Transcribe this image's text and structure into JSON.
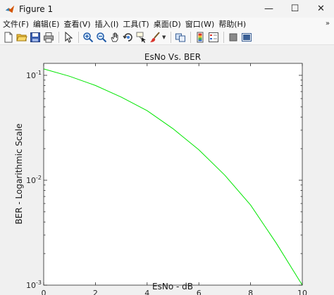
{
  "window": {
    "title": "Figure 1",
    "controls": {
      "minimize": "—",
      "maximize": "☐",
      "close": "✕"
    }
  },
  "menu": {
    "items": [
      "文件(F)",
      "编辑(E)",
      "查看(V)",
      "插入(I)",
      "工具(T)",
      "桌面(D)",
      "窗口(W)",
      "帮助(H)"
    ],
    "overflow_arrow": "»"
  },
  "toolbar": {
    "buttons": [
      "new-figure",
      "open-file",
      "save",
      "print",
      "select-pointer",
      "zoom-in",
      "zoom-out",
      "pan",
      "rotate-3d",
      "data-cursor",
      "brush",
      "link-plot",
      "insert-colorbar",
      "insert-legend",
      "hide-plot-tools",
      "show-plot-tools"
    ]
  },
  "colors": {
    "line": "#00e600",
    "axes_bg": "#ffffff",
    "figure_bg": "#f0f0f0"
  },
  "chart_data": {
    "type": "line",
    "title": "EsNo Vs. BER",
    "xlabel": "EsNo - dB",
    "ylabel": "BER - Logarithmic Scale",
    "y_scale": "log",
    "xlim": [
      0,
      10
    ],
    "ylim": [
      0.001,
      0.13
    ],
    "grid": false,
    "x_ticks": [
      "0",
      "2",
      "4",
      "6",
      "8",
      "10"
    ],
    "y_ticks": [
      {
        "base": "10",
        "exp": "-1",
        "value": 0.1
      },
      {
        "base": "10",
        "exp": "-2",
        "value": 0.01
      },
      {
        "base": "10",
        "exp": "-3",
        "value": 0.001
      }
    ],
    "series": [
      {
        "x": [
          0,
          1,
          2,
          3,
          4,
          5,
          6,
          7,
          8,
          9,
          10
        ],
        "y": [
          0.115,
          0.098,
          0.08,
          0.062,
          0.046,
          0.031,
          0.0195,
          0.0112,
          0.0058,
          0.0025,
          0.001
        ]
      }
    ]
  }
}
